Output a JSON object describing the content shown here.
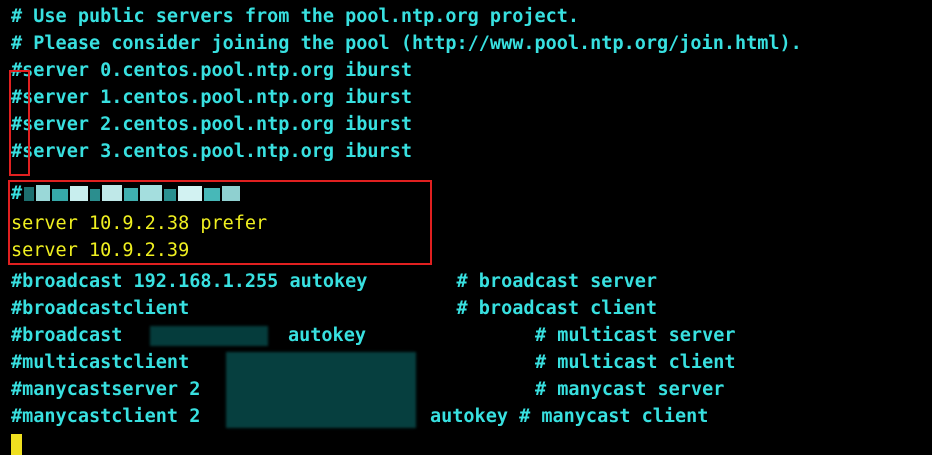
{
  "terminal": {
    "lines": {
      "comment1": "# Use public servers from the pool.ntp.org project.",
      "comment2": "# Please consider joining the pool (http://www.pool.ntp.org/join.html).",
      "server0": "#server 0.centos.pool.ntp.org iburst",
      "server1": "#server 1.centos.pool.ntp.org iburst",
      "server2": "#server 2.centos.pool.ntp.org iburst",
      "server3": "#server 3.centos.pool.ntp.org iburst",
      "redacted_comment_hash": "#",
      "server_prefer": "server 10.9.2.38 prefer",
      "server_second": "server 10.9.2.39",
      "broadcast_line": "#broadcast 192.168.1.255 autokey        # broadcast server",
      "broadcastclient_line": "#broadcastclient                        # broadcast client",
      "broadcast_prefix": "#broadcast",
      "broadcast_autokey": "autokey",
      "multicast_server_comment": "# multicast server",
      "multicastclient_prefix": "#multicastclient",
      "multicast_client_comment": "# multicast client",
      "manycastserver_prefix": "#manycastserver 2",
      "manycast_server_comment": "# manycast server",
      "manycastclient_prefix": "#manycastclient 2",
      "manycastclient_suffix": "autokey # manycast client"
    },
    "colors": {
      "background": "#000000",
      "cyan_text": "#38e0e0",
      "yellow_text": "#f0f020",
      "highlight_box": "#e02020",
      "cursor": "#f0e020"
    }
  }
}
